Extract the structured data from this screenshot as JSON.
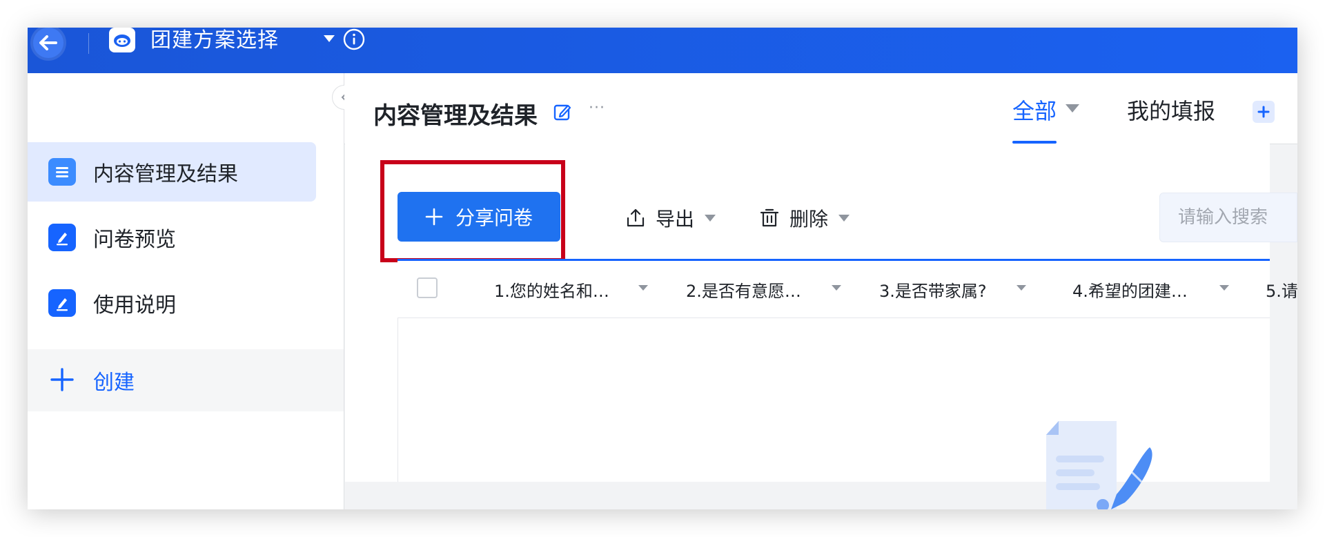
{
  "app": {
    "title": "团建方案选择"
  },
  "sidebar": {
    "items": [
      {
        "label": "内容管理及结果",
        "active": true,
        "icon": "list-doc-icon"
      },
      {
        "label": "问卷预览",
        "active": false,
        "icon": "pen-edit-icon"
      },
      {
        "label": "使用说明",
        "active": false,
        "icon": "pen-edit-icon"
      }
    ],
    "create_label": "创建"
  },
  "header": {
    "title": "内容管理及结果",
    "more": "···",
    "tabs": [
      {
        "label": "全部",
        "active": true
      },
      {
        "label": "我的填报",
        "active": false
      }
    ]
  },
  "toolbar": {
    "share_label": "分享问卷",
    "export_label": "导出",
    "delete_label": "删除",
    "search_placeholder": "请输入搜索"
  },
  "table": {
    "columns": [
      "1.您的姓名和…",
      "2.是否有意愿…",
      "3.是否带家属?",
      "4.希望的团建…",
      "5.请"
    ]
  },
  "colors": {
    "topbar": "#1b61f0",
    "primary": "#1664ff",
    "highlight": "#c8001a",
    "sidebar_active": "#e1eaff"
  }
}
